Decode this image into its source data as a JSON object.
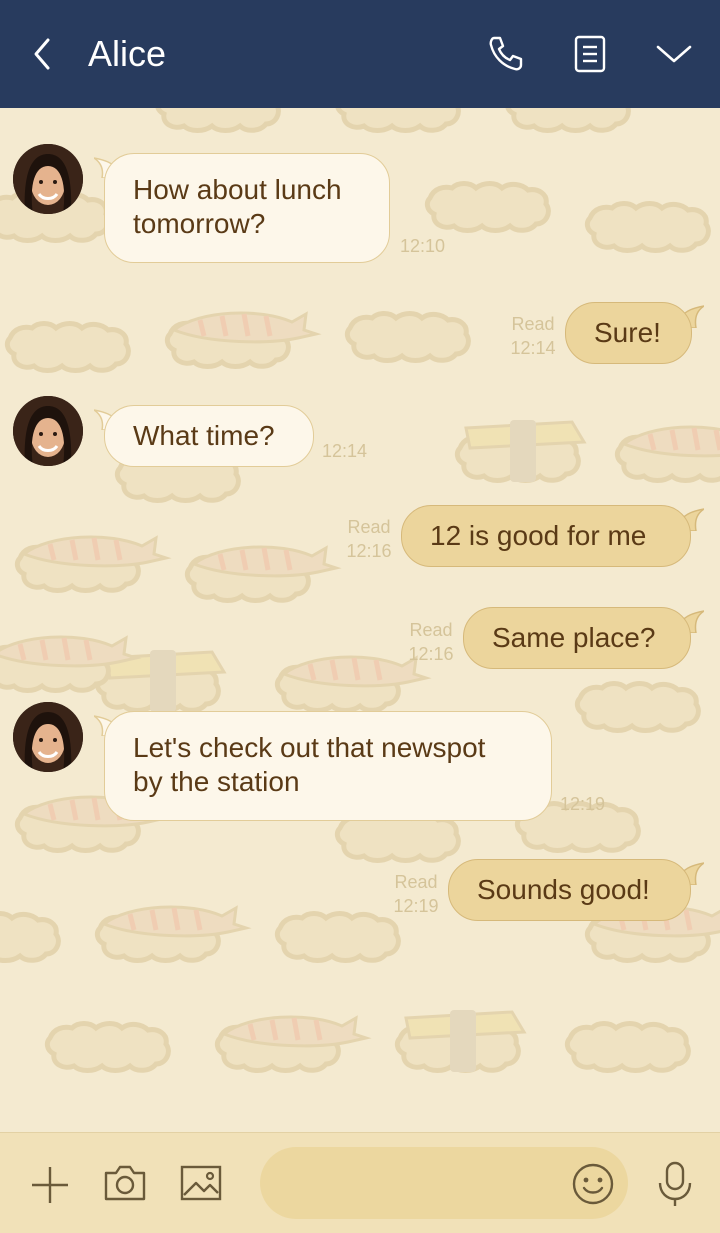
{
  "header": {
    "contact_name": "Alice"
  },
  "messages": [
    {
      "side": "in",
      "lines": [
        "How about lunch",
        "tomorrow?"
      ],
      "time": "12:10"
    },
    {
      "side": "out",
      "text": "Sure!",
      "read": "Read",
      "time": "12:14"
    },
    {
      "side": "in",
      "lines": [
        "What time?"
      ],
      "time": "12:14"
    },
    {
      "side": "out",
      "text": "12 is good for me",
      "read": "Read",
      "time": "12:16"
    },
    {
      "side": "out",
      "text": "Same place?",
      "read": "Read",
      "time": "12:16"
    },
    {
      "side": "in",
      "lines": [
        "Let's check out that newspot",
        "by the station"
      ],
      "time": "12:19"
    },
    {
      "side": "out",
      "text": "Sounds good!",
      "read": "Read",
      "time": "12:19"
    }
  ],
  "input": {
    "placeholder": ""
  },
  "colors": {
    "header_bg": "#283b5e",
    "chat_bg": "#f4ead0",
    "incoming_bubble": "#fdf7ea",
    "outgoing_bubble": "#ecd59c",
    "text": "#5a3a16",
    "timestamp": "#d5c49a"
  },
  "icons": {
    "back": "chevron-left-icon",
    "call": "phone-icon",
    "notes": "notes-icon",
    "menu": "chevron-down-icon",
    "add": "plus-icon",
    "camera": "camera-icon",
    "image": "image-icon",
    "emoji": "emoji-icon",
    "mic": "microphone-icon"
  }
}
